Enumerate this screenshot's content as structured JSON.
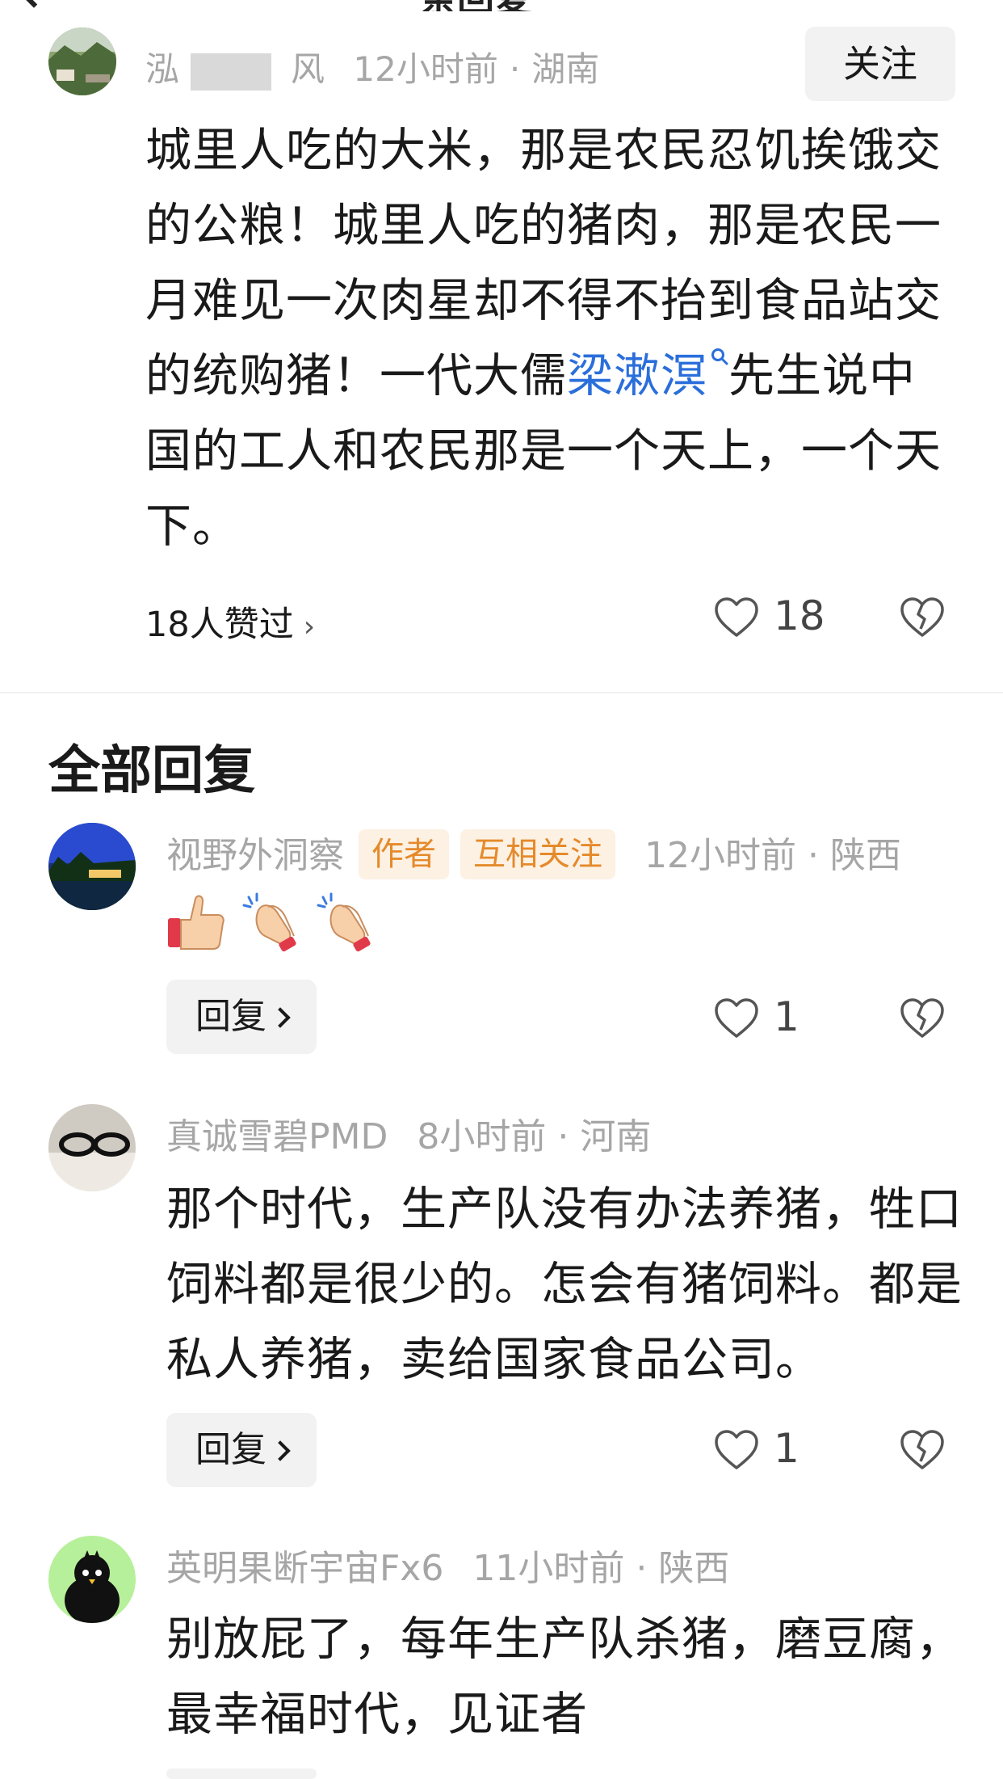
{
  "header": {
    "title_fragment": "条回复"
  },
  "main_comment": {
    "user_prefix": "泓",
    "user_suffix": "风",
    "time": "12小时前",
    "location": "湖南",
    "follow_label": "关注",
    "text_before_link": "城里人吃的大米，那是农民忍饥挨饿交的公粮！城里人吃的猪肉，那是农民一月难见一次肉星却不得不抬到食品站交的统购猪！一代大儒",
    "link_text": "梁漱溟",
    "text_after_link": "先生说中国的工人和农民那是一个天上，一个天下。",
    "liked_by": "18人赞过",
    "like_count": "18"
  },
  "section": {
    "title": "全部回复"
  },
  "replies": [
    {
      "user": "视野外洞察",
      "tags": [
        "作者",
        "互相关注"
      ],
      "time": "12小时前",
      "location": "陕西",
      "emoji": [
        "thumbs-up",
        "clapping-hands",
        "clapping-hands"
      ],
      "reply_label": "回复",
      "like_count": "1"
    },
    {
      "user": "真诚雪碧PMD",
      "time": "8小时前",
      "location": "河南",
      "text": "那个时代，生产队没有办法养猪，牲口饲料都是很少的。怎会有猪饲料。都是私人养猪，卖给国家食品公司。",
      "reply_label": "回复",
      "like_count": "1"
    },
    {
      "user": "英明果断宇宙Fx6",
      "time": "11小时前",
      "location": "陕西",
      "text": "别放屁了，每年生产队杀猪，磨豆腐，最幸福时代，见证者"
    }
  ],
  "meta_separator": "·",
  "colors": {
    "link": "#2a6edb",
    "tag_bg": "#fdf1e3",
    "tag_text": "#e58a2b",
    "meta": "#a6a6a6"
  }
}
